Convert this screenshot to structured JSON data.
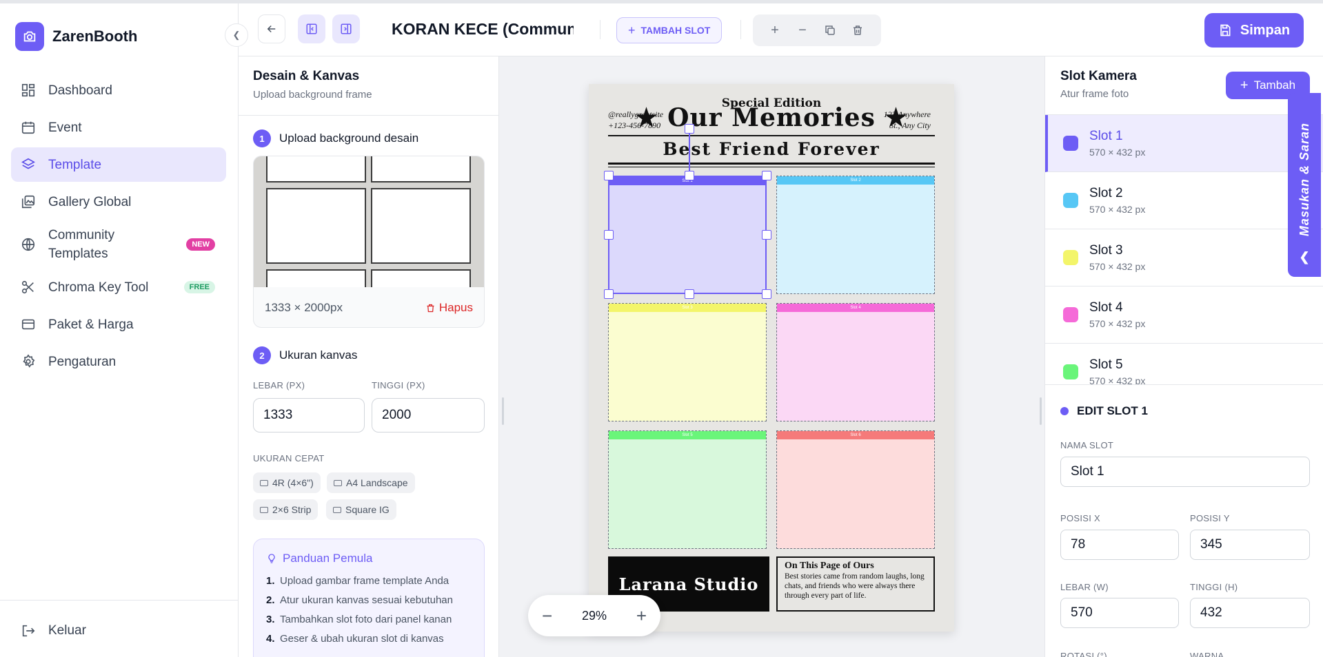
{
  "app": {
    "name": "ZarenBooth"
  },
  "sidebar": {
    "items": [
      {
        "label": "Dashboard",
        "icon": "dashboard-icon"
      },
      {
        "label": "Event",
        "icon": "calendar-icon"
      },
      {
        "label": "Template",
        "icon": "layers-icon",
        "active": true
      },
      {
        "label": "Gallery Global",
        "icon": "gallery-icon"
      },
      {
        "label": "Community Templates",
        "icon": "globe-icon",
        "badge": "NEW"
      },
      {
        "label": "Chroma Key Tool",
        "icon": "scissors-icon",
        "badge": "FREE"
      },
      {
        "label": "Paket & Harga",
        "icon": "card-icon"
      },
      {
        "label": "Pengaturan",
        "icon": "gear-icon"
      }
    ],
    "logout": "Keluar"
  },
  "topbar": {
    "title": "KORAN KECE (Community)",
    "add_slot": "TAMBAH SLOT",
    "save": "Simpan"
  },
  "left_panel": {
    "title": "Desain & Kanvas",
    "subtitle": "Upload background frame",
    "step1": {
      "num": "1",
      "label": "Upload background desain"
    },
    "bg_size": "1333 × 2000px",
    "delete": "Hapus",
    "step2": {
      "num": "2",
      "label": "Ukuran kanvas"
    },
    "width_label": "LEBAR (PX)",
    "width_value": "1333",
    "height_label": "TINGGI (PX)",
    "height_value": "2000",
    "quick_label": "UKURAN CEPAT",
    "quick_sizes": [
      "4R (4×6\")",
      "A4 Landscape",
      "2×6 Strip",
      "Square IG"
    ],
    "guide": {
      "title": "Panduan Pemula",
      "steps": [
        {
          "num": "1.",
          "text": "Upload gambar frame template Anda"
        },
        {
          "num": "2.",
          "text": "Atur ukuran kanvas sesuai kebutuhan"
        },
        {
          "num": "3.",
          "text": "Tambahkan slot foto dari panel kanan"
        },
        {
          "num": "4.",
          "text": "Geser & ubah ukuran slot di kanvas"
        }
      ]
    }
  },
  "canvas": {
    "edition": "Special Edition",
    "title": "★ Our Memories ★",
    "left_info": [
      "@reallygreatsite",
      "+123-456-7890"
    ],
    "right_info": [
      "123 Anywhere",
      "St., Any City"
    ],
    "subtitle": "Best Friend Forever",
    "studio": "Larana Studio",
    "news_title": "On This Page of Ours",
    "news_body": "Best stories came from random laughs, long chats, and friends who were always there through every part of life.",
    "slot_labels": [
      "Slot 1",
      "Slot 2",
      "Slot 3",
      "Slot 4",
      "Slot 5",
      "Slot 6"
    ],
    "slot_colors": [
      "#6d5df5",
      "#57c7f5",
      "#f3f56a",
      "#f56ad8",
      "#6af57a",
      "#f57a7a"
    ],
    "zoom": "29%"
  },
  "right_panel": {
    "title": "Slot Kamera",
    "subtitle": "Atur frame foto",
    "add": "Tambah",
    "slots": [
      {
        "name": "Slot 1",
        "size": "570 × 432 px",
        "color": "#6d5df5"
      },
      {
        "name": "Slot 2",
        "size": "570 × 432 px",
        "color": "#57c7f5"
      },
      {
        "name": "Slot 3",
        "size": "570 × 432 px",
        "color": "#f3f56a"
      },
      {
        "name": "Slot 4",
        "size": "570 × 432 px",
        "color": "#f56ad8"
      },
      {
        "name": "Slot 5",
        "size": "570 × 432 px",
        "color": "#6af57a"
      }
    ],
    "edit": {
      "title": "EDIT SLOT 1",
      "name_label": "NAMA SLOT",
      "name_value": "Slot 1",
      "x_label": "POSISI X",
      "x_value": "78",
      "y_label": "POSISI Y",
      "y_value": "345",
      "w_label": "LEBAR (W)",
      "w_value": "570",
      "h_label": "TINGGI (H)",
      "h_value": "432",
      "rot_label": "ROTASI (°)",
      "color_label": "WARNA"
    }
  },
  "feedback": "Masukan & Saran"
}
